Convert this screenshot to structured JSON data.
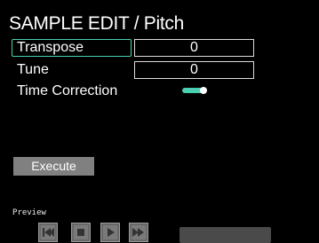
{
  "header": {
    "title": "SAMPLE EDIT / Pitch"
  },
  "params": [
    {
      "label": "Transpose",
      "value": "0"
    },
    {
      "label": "Tune",
      "value": "0"
    }
  ],
  "time_correction": {
    "label": "Time Correction",
    "state": "on"
  },
  "execute": {
    "label": "Execute"
  },
  "preview": {
    "label": "Preview",
    "buttons": [
      "skip-to-start-icon",
      "stop-icon",
      "play-icon",
      "fast-forward-icon"
    ]
  },
  "colors": {
    "accent": "#4ad0b0",
    "background": "#000000",
    "button": "#808080"
  }
}
